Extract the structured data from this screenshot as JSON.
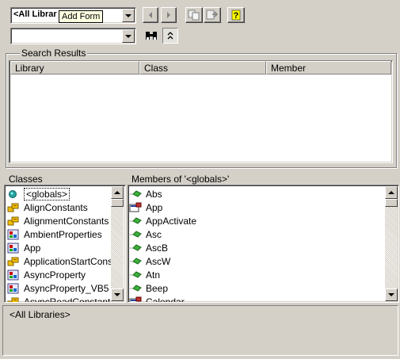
{
  "toolbar": {
    "library_combo_value": "<All Librar",
    "search_combo_value": "",
    "tooltip_text": "Add Form",
    "icons": [
      "back-arrow-icon",
      "forward-arrow-icon",
      "copy-icon",
      "view-definition-icon",
      "help-icon",
      "binoculars-icon",
      "collapse-chevron-icon"
    ]
  },
  "search_results": {
    "title": "Search Results",
    "columns": [
      "Library",
      "Class",
      "Member"
    ]
  },
  "classes_pane": {
    "title": "Classes",
    "items": [
      {
        "label": "<globals>",
        "icon": "globals-sphere-icon",
        "selected": true
      },
      {
        "label": "AlignConstants",
        "icon": "enum-icon"
      },
      {
        "label": "AlignmentConstants",
        "icon": "enum-icon"
      },
      {
        "label": "AmbientProperties",
        "icon": "class-icon"
      },
      {
        "label": "App",
        "icon": "class-icon"
      },
      {
        "label": "ApplicationStartCons",
        "icon": "enum-icon"
      },
      {
        "label": "AsyncProperty",
        "icon": "class-icon"
      },
      {
        "label": "AsyncProperty_VB5",
        "icon": "class-icon"
      },
      {
        "label": "AsyncReadConstant",
        "icon": "enum-icon"
      }
    ]
  },
  "members_pane": {
    "title": "Members of '<globals>'",
    "items": [
      {
        "label": "Abs",
        "icon": "method-icon"
      },
      {
        "label": "App",
        "icon": "property-icon"
      },
      {
        "label": "AppActivate",
        "icon": "method-icon"
      },
      {
        "label": "Asc",
        "icon": "method-icon"
      },
      {
        "label": "AscB",
        "icon": "method-icon"
      },
      {
        "label": "AscW",
        "icon": "method-icon"
      },
      {
        "label": "Atn",
        "icon": "method-icon"
      },
      {
        "label": "Beep",
        "icon": "method-icon"
      },
      {
        "label": "Calendar",
        "icon": "property-icon"
      }
    ]
  },
  "details": {
    "text": "<All Libraries>"
  }
}
